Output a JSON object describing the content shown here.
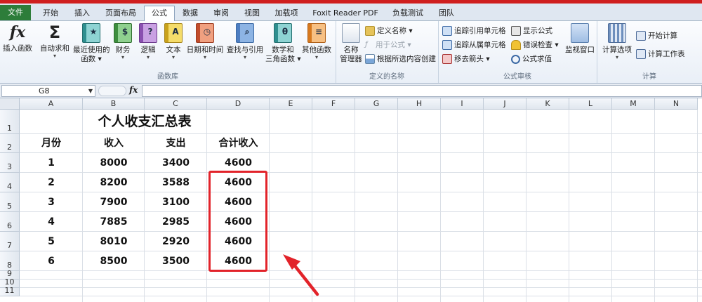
{
  "ribbon_tabs": [
    "文件",
    "开始",
    "插入",
    "页面布局",
    "公式",
    "数据",
    "审阅",
    "视图",
    "加载项",
    "Foxit Reader PDF",
    "负载测试",
    "团队"
  ],
  "ribbon": {
    "function_library": {
      "label": "函数库",
      "insert_function": "插入函数",
      "autosum": "自动求和",
      "recent_line1": "最近使用的",
      "recent_line2": "函数",
      "finance": "财务",
      "logical": "逻辑",
      "text": "文本",
      "datetime": "日期和时间",
      "lookup": "查找与引用",
      "math_line1": "数学和",
      "math_line2": "三角函数",
      "other": "其他函数"
    },
    "defined_names": {
      "label": "定义的名称",
      "name_manager_line1": "名称",
      "name_manager_line2": "管理器",
      "define_name": "定义名称",
      "use_in_formula": "用于公式",
      "create_from_selection": "根据所选内容创建"
    },
    "formula_auditing": {
      "label": "公式审核",
      "trace_precedents": "追踪引用单元格",
      "trace_dependents": "追踪从属单元格",
      "remove_arrows": "移去箭头",
      "show_formulas": "显示公式",
      "error_checking": "错误检查",
      "evaluate_formula": "公式求值",
      "watch_window": "监视窗口"
    },
    "calculation": {
      "label": "计算",
      "calc_options": "计算选项",
      "calc_now": "开始计算",
      "calc_sheet": "计算工作表"
    },
    "fx_glyph": "fx",
    "sigma_glyph": "Σ",
    "finance_glyph": "$",
    "logical_glyph": "?",
    "text_glyph": "A",
    "math_glyph": "θ"
  },
  "formula_bar": {
    "name_box": "G8",
    "fx_label": "fx",
    "formula": ""
  },
  "columns": [
    "A",
    "B",
    "C",
    "D",
    "E",
    "F",
    "G",
    "H",
    "I",
    "J",
    "K",
    "L",
    "M",
    "N"
  ],
  "rows": [
    "1",
    "2",
    "3",
    "4",
    "5",
    "6",
    "7",
    "8",
    "9",
    "10",
    "11"
  ],
  "sheet": {
    "title": "个人收支汇总表",
    "headers": [
      "月份",
      "收入",
      "支出",
      "合计收入"
    ],
    "data": [
      [
        "1",
        "8000",
        "3400",
        "4600"
      ],
      [
        "2",
        "8200",
        "3588",
        "4600"
      ],
      [
        "3",
        "7900",
        "3100",
        "4600"
      ],
      [
        "4",
        "7885",
        "2985",
        "4600"
      ],
      [
        "5",
        "8010",
        "2920",
        "4600"
      ],
      [
        "6",
        "8500",
        "3500",
        "4600"
      ]
    ]
  },
  "colors": {
    "highlight": "#e2232a",
    "file_tab": "#2d7d3a"
  }
}
